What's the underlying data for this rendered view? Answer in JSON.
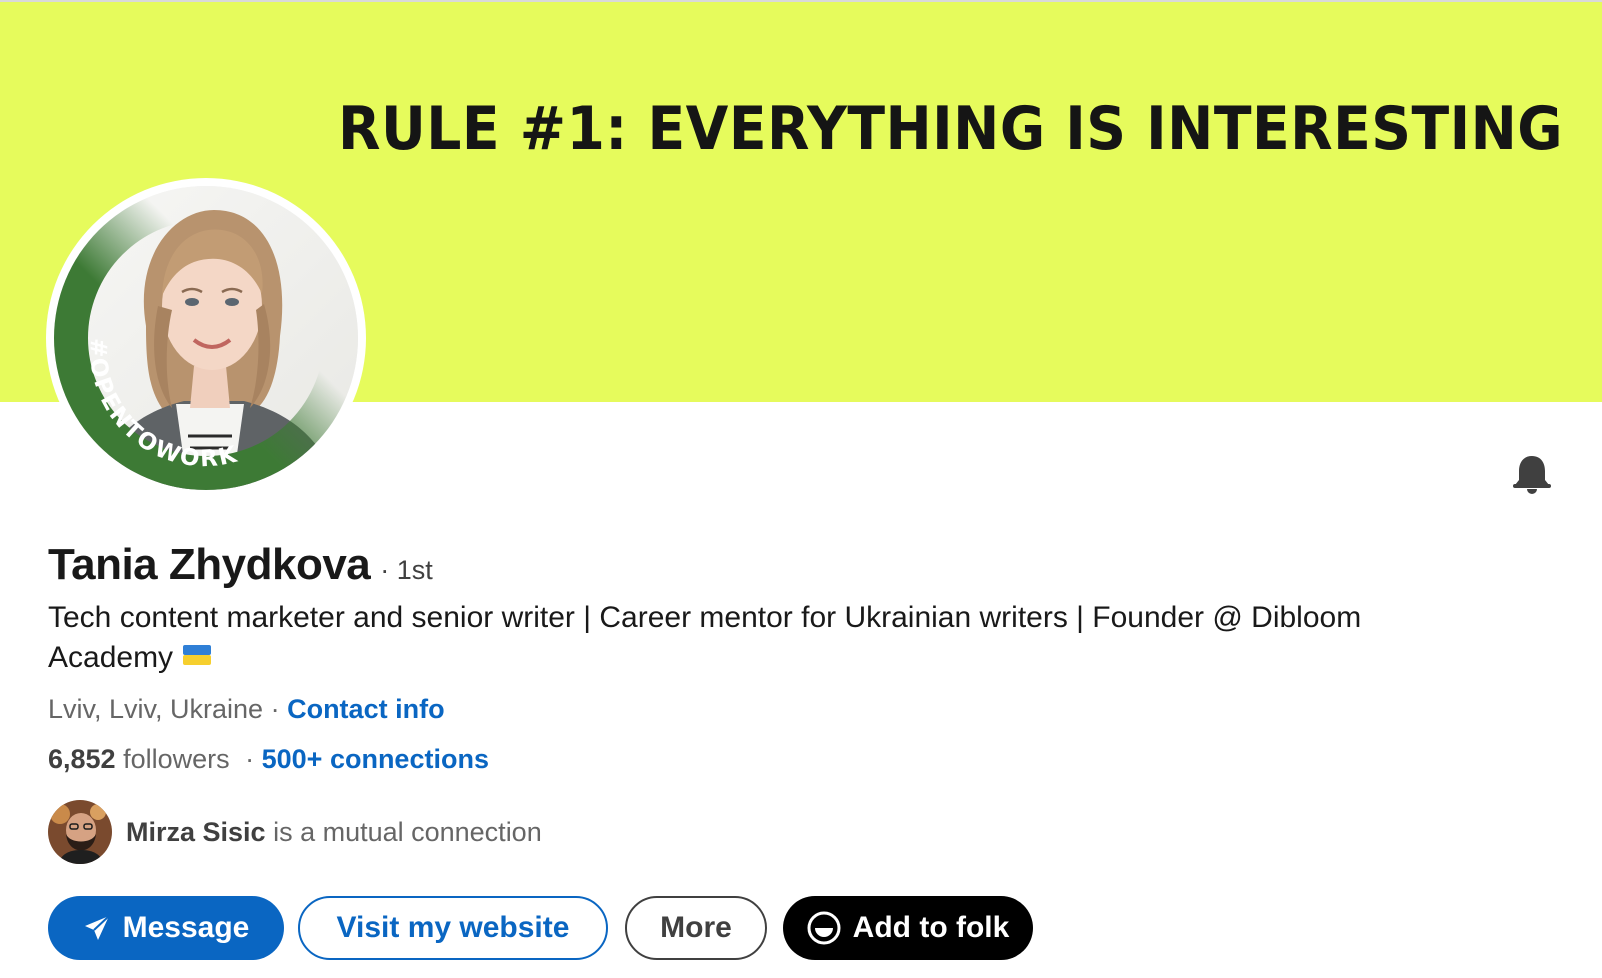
{
  "banner": {
    "text": "RULE #1: EVERYTHING IS INTERESTING",
    "color": "#e6fb5c"
  },
  "avatar": {
    "frame_label": "#OPENTOWORK",
    "frame_color": "#3d7a35"
  },
  "profile": {
    "name": "Tania Zhydkova",
    "degree": "· 1st",
    "headline": "Tech content marketer and senior writer | Career mentor for Ukrainian writers | Founder @ Dibloom Academy",
    "headline_emoji_icon": "ukraine-flag-icon",
    "location": "Lviv, Lviv, Ukraine",
    "separator": " · ",
    "contact_info": "Contact info",
    "followers_count": "6,852",
    "followers_label": " followers",
    "followers_separator": " · ",
    "connections": "500+ connections",
    "mutual_name": "Mirza Sisic",
    "mutual_suffix": " is a mutual connection"
  },
  "actions": {
    "message": "Message",
    "website": "Visit my website",
    "more": "More",
    "folk": "Add to folk"
  },
  "icons": {
    "notification": "bell-icon",
    "message": "send-icon",
    "folk": "folk-logo-icon"
  },
  "colors": {
    "accent": "#0a66c2",
    "folk_button": "#000000"
  }
}
